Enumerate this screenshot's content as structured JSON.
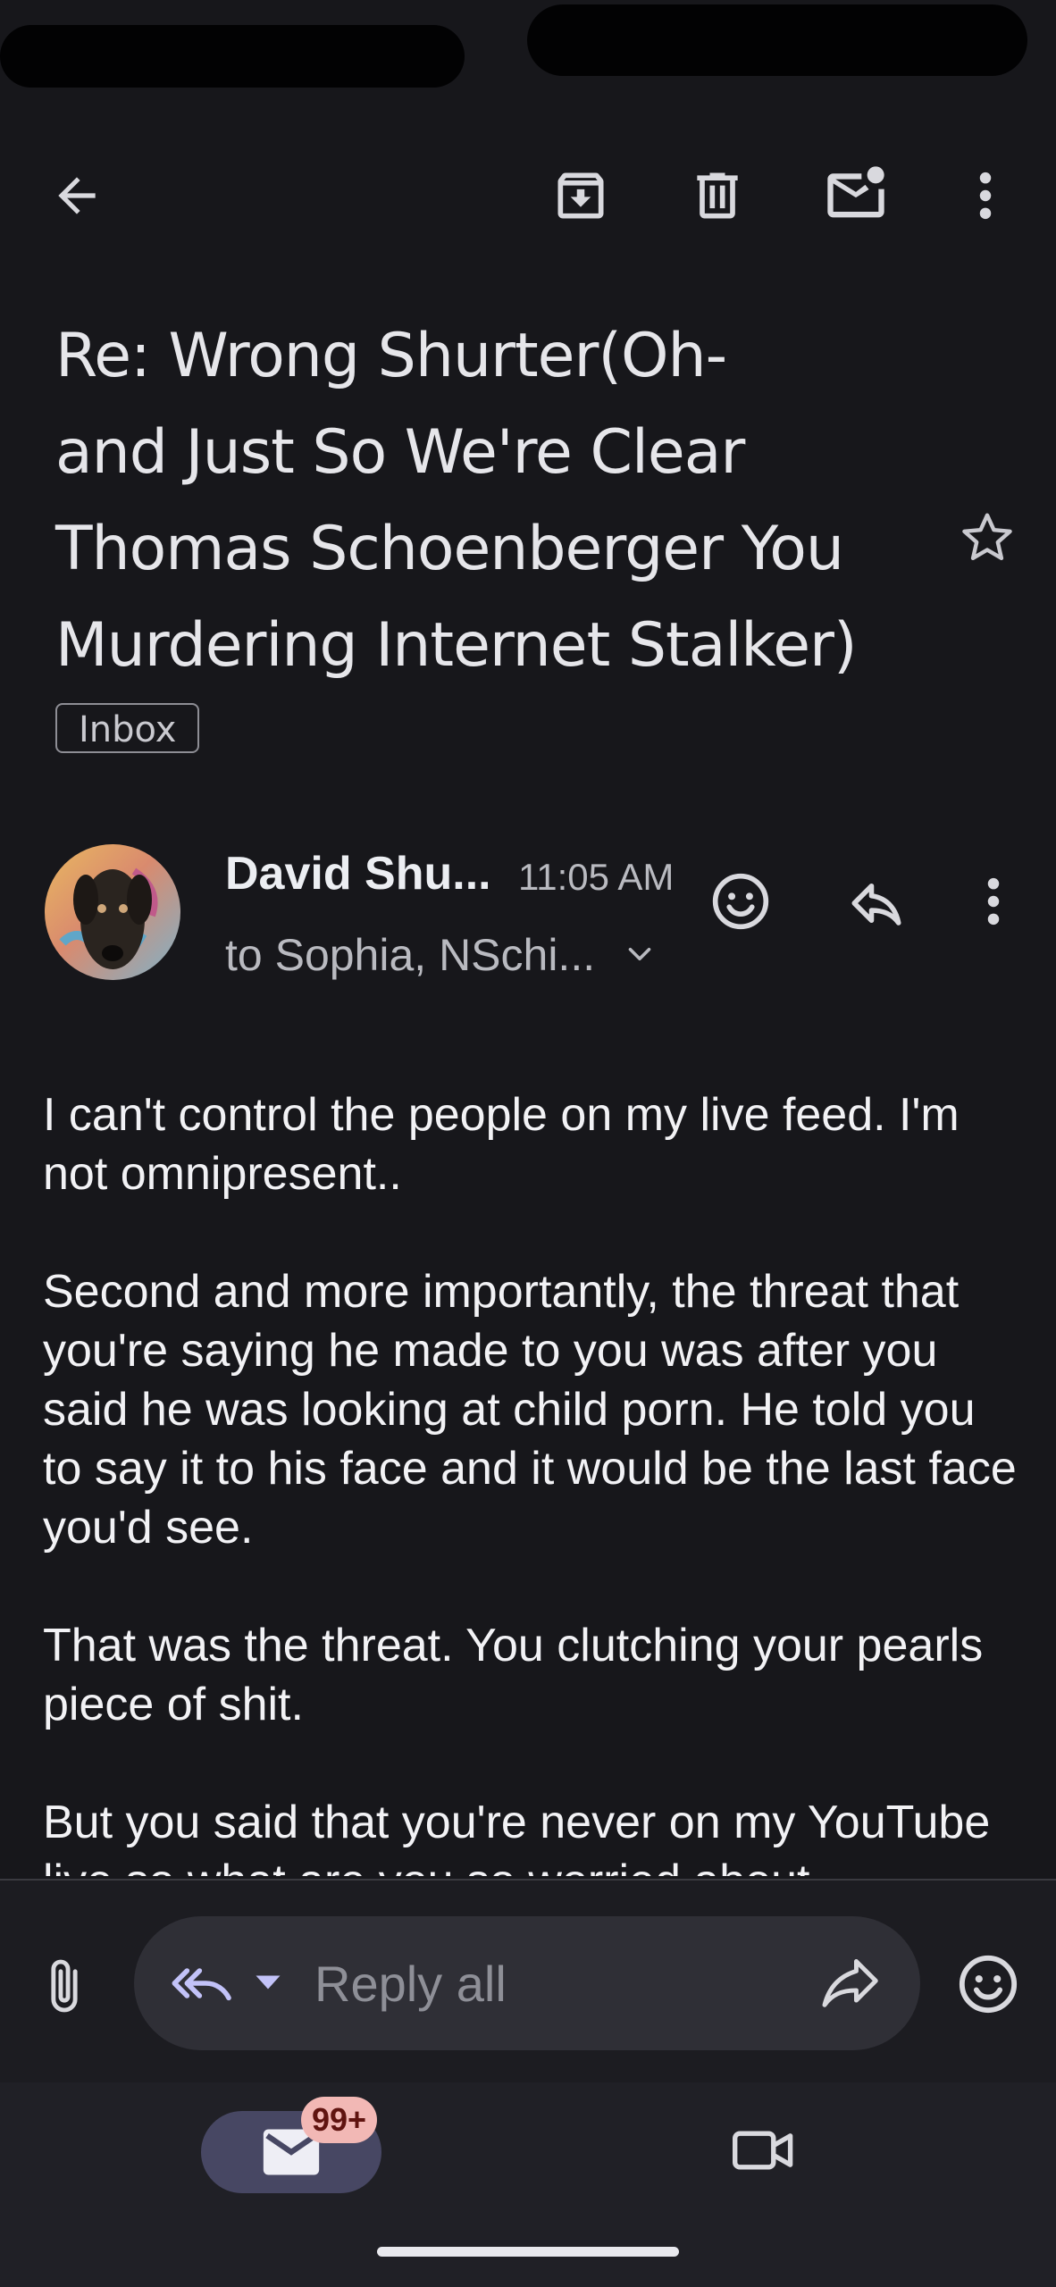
{
  "toolbar": {
    "back_icon": "arrow-back-icon",
    "archive_icon": "archive-icon",
    "delete_icon": "trash-icon",
    "mark_unread_icon": "mark-unread-mail-icon",
    "more_icon": "more-vert-icon"
  },
  "email": {
    "subject_lines": [
      "Re: Wrong Shurter(Oh-",
      "and Just So We're Clear",
      "Thomas Schoenberger You",
      "Murdering Internet Stalker)"
    ],
    "label": "Inbox",
    "sender": "David Shu...",
    "time": "11:05 AM",
    "recipients": "to Sophia, NSchi...",
    "body_paragraphs": [
      "I can't control the people on my live feed. I'm not omnipresent..",
      "Second and more importantly, the threat that you're saying he made to you was after you said he was looking at child porn. He told you to say it to his face and it would be the last face you'd see.",
      "That was the threat. You clutching your pearls piece of shit.",
      "But you said that you're never on my YouTube live so what are you so worried about"
    ]
  },
  "compose": {
    "reply_all_placeholder": "Reply all"
  },
  "bottom_nav": {
    "mail_badge": "99+"
  },
  "colors": {
    "background": "#17171b",
    "reply_accent": "#c2c2f8",
    "badge_bg": "#f2b8b5",
    "mail_pill": "#474763"
  }
}
